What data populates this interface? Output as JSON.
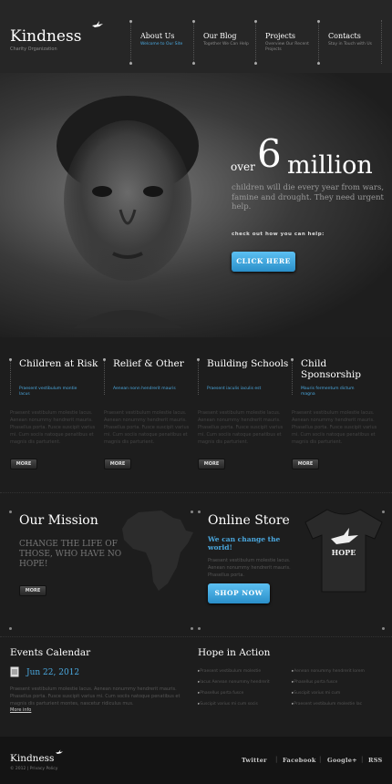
{
  "header": {
    "logo": "Kindness",
    "tagline": "Charity Organization",
    "nav": [
      {
        "title": "About Us",
        "subtitle": "Welcome to Our Site"
      },
      {
        "title": "Our Blog",
        "subtitle": "Together We Can Help"
      },
      {
        "title": "Projects",
        "subtitle": "Overview Our Recent Projects"
      },
      {
        "title": "Contacts",
        "subtitle": "Stay in Touch with Us"
      }
    ]
  },
  "hero": {
    "over": "over",
    "number": "6",
    "unit": "million",
    "text": "children will die every year from wars, famine and drought. They need urgent help.",
    "prompt": "check out how you can help:",
    "button": "CLICK HERE"
  },
  "columns": [
    {
      "title": "Children at Risk",
      "subtitle": "Praesent vestibulum montie lacus",
      "body": "Praesent vestibulum molestie lacus. Aenean nonummy hendrerit mauris. Phasellus porta. Fusce suscipit varius mi. Cum sociis natoque penatibus et magnis dis parturient.",
      "button": "MORE"
    },
    {
      "title": "Relief & Other",
      "subtitle": "Aenean nonn hendrerit mauris",
      "body": "Praesent vestibulum molestie lacus. Aenean nonummy hendrerit mauris. Phasellus porta. Fusce suscipit varius mi. Cum sociis natoque penatibus et magnis dis parturient.",
      "button": "MORE"
    },
    {
      "title": "Building Schools",
      "subtitle": "Praesent iaculis iaculis est",
      "body": "Praesent vestibulum molestie lacus. Aenean nonummy hendrerit mauris. Phasellus porta. Fusce suscipit varius mi. Cum sociis natoque penatibus et magnis dis parturient.",
      "button": "MORE"
    },
    {
      "title": "Child Sponsorship",
      "subtitle": "Mauris fermentum dictum magna",
      "body": "Praesent vestibulum molestie lacus. Aenean nonummy hendrerit mauris. Phasellus porta. Fusce suscipit varius mi. Cum sociis natoque penatibus et magnis dis parturient.",
      "button": "MORE"
    }
  ],
  "mission": {
    "title": "Our Mission",
    "text": "CHANGE THE LIFE OF THOSE, WHO HAVE NO HOPE!",
    "button": "MORE"
  },
  "store": {
    "title": "Online Store",
    "tagline": "We can change the world!",
    "text": "Praesent vestibulum molestie lacus. Aenean nonummy hendrerit mauris. Phasellus porta.",
    "button": "SHOP NOW",
    "shirt_label": "HOPE"
  },
  "events": {
    "title": "Events Calendar",
    "date": "Jun 22, 2012",
    "text": "Praesent vestibulum molestie lacus. Aenean nonummy hendrerit mauris. Phasellus porta. Fusce suscipit varius mi. Cum sociis natoque penatibus et magnis dis parturient montes, nascetur ridiculus mus.",
    "more": "More info"
  },
  "hope": {
    "title": "Hope in Action",
    "left": [
      "Praesent vestibulum molestie",
      "Iacus Aenean nonummy hendrerit",
      "Phasellus porta fusce",
      "Suscipit varius mi cum socis"
    ],
    "right": [
      "Aenean nonummy hendrerit lorem",
      "Phasellus porta fusce",
      "Suscipit varius mi cum",
      "Praesent vestibulum molestie lac"
    ]
  },
  "footer": {
    "logo": "Kindness",
    "copyright": "© 2012  |  Privacy Policy",
    "social": [
      "Twitter",
      "Facebook",
      "Google+",
      "RSS"
    ]
  },
  "colors": {
    "accent": "#4aa8df",
    "background": "#1d1d1d",
    "header": "#262626",
    "footer": "#141414"
  }
}
